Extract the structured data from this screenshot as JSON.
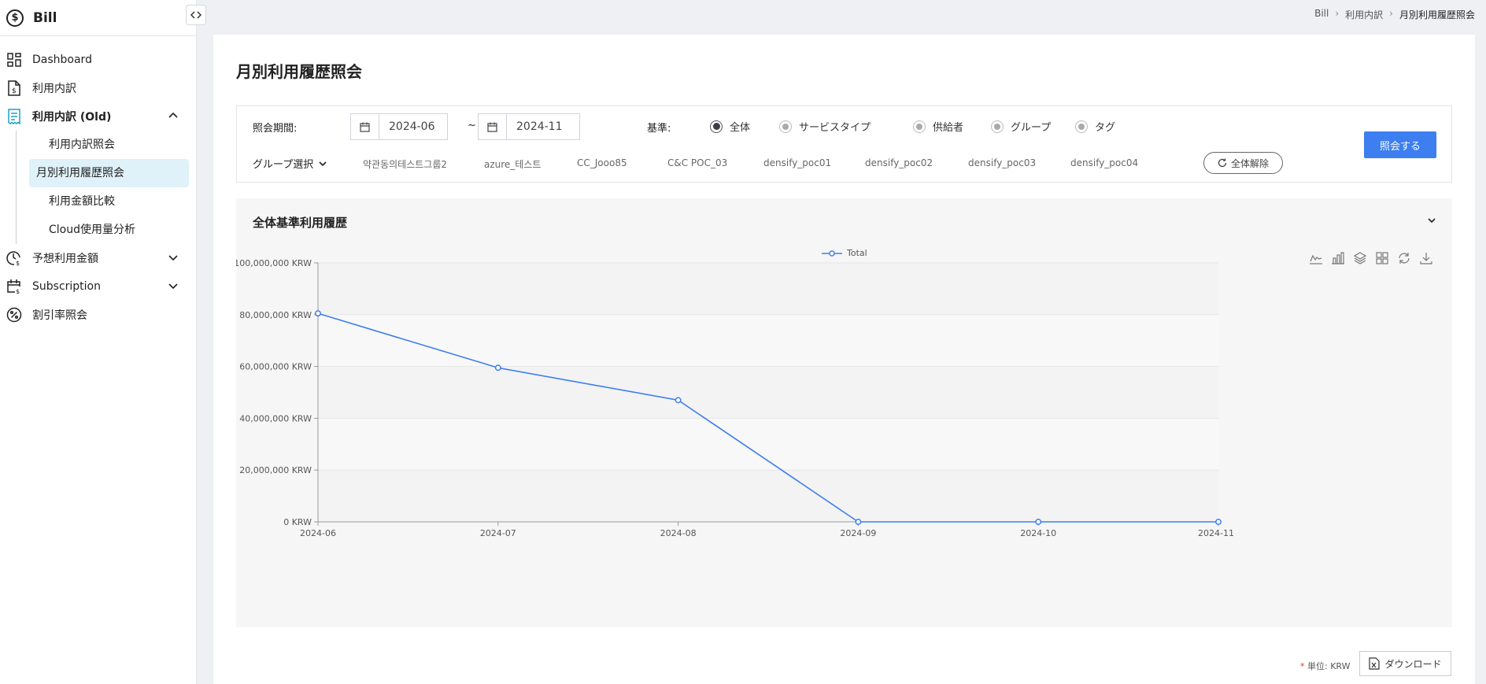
{
  "app": {
    "title": "Bill"
  },
  "sidebar": {
    "items": [
      {
        "label": "Dashboard",
        "icon": "dashboard-icon"
      },
      {
        "label": "利用内訳",
        "icon": "document-dollar-icon"
      },
      {
        "label": "利用内訳 (Old)",
        "icon": "receipt-icon",
        "active": true,
        "expanded": true
      },
      {
        "label": "予想利用金額",
        "icon": "clock-dollar-icon"
      },
      {
        "label": "Subscription",
        "icon": "calendar-dollar-icon"
      },
      {
        "label": "割引率照会",
        "icon": "percent-icon"
      }
    ],
    "sub_items": [
      "利用内訳照会",
      "月別利用履歴照会",
      "利用金額比較",
      "Cloud使用量分析"
    ],
    "active_sub": "月別利用履歴照会",
    "accent": "#1aa0c9"
  },
  "breadcrumb": [
    "Bill",
    "利用内訳",
    "月別利用履歴照会"
  ],
  "page": {
    "title": "月別利用履歴照会"
  },
  "filter": {
    "period_label": "照会期間:",
    "date_from": "2024-06",
    "date_sep": "~",
    "date_to": "2024-11",
    "basis_label": "基準:",
    "radios": [
      "全体",
      "サービスタイプ",
      "供給者",
      "グループ",
      "タグ"
    ],
    "selected_radio": "全体",
    "group_select_label": "グループ選択",
    "groups": [
      "약관동의테스트그룹2",
      "azure_테스트",
      "CC_Jooo85",
      "C&C POC_03",
      "densify_poc01",
      "densify_poc02",
      "densify_poc03",
      "densify_poc04"
    ],
    "reset_label": "全体解除",
    "search_label": "照会する",
    "primary_color": "#3d7ef0"
  },
  "chart_panel": {
    "title": "全体基準利用履歴",
    "tools": [
      "line-chart-icon",
      "bar-chart-icon",
      "stack-icon",
      "grid-icon",
      "refresh-icon",
      "download-icon"
    ]
  },
  "chart_data": {
    "type": "line",
    "x": [
      "2024-06",
      "2024-07",
      "2024-08",
      "2024-09",
      "2024-10",
      "2024-11"
    ],
    "series": [
      {
        "name": "Total",
        "values": [
          80500000,
          59500000,
          47000000,
          0,
          0,
          0
        ],
        "color": "#3d7ef0"
      }
    ],
    "yticks": [
      "0 KRW",
      "20,000,000 KRW",
      "40,000,000 KRW",
      "60,000,000 KRW",
      "80,000,000 KRW",
      "100,000,000 KRW"
    ],
    "ylim": [
      0,
      100000000
    ],
    "legend": "top-center",
    "grid": true
  },
  "footer": {
    "unit_marker": "*",
    "unit_label": "単位: KRW",
    "download_label": "ダウンロード"
  }
}
